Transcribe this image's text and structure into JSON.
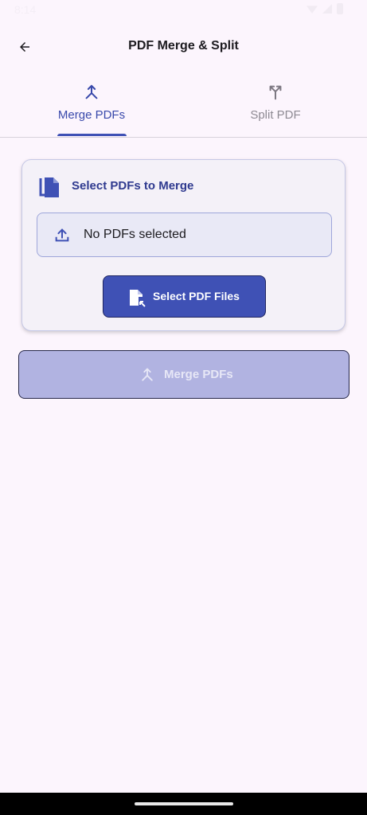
{
  "status_bar": {
    "time": "8:14"
  },
  "app_bar": {
    "title": "PDF Merge & Split"
  },
  "tabs": [
    {
      "label": "Merge PDFs",
      "icon": "merge-icon",
      "active": true
    },
    {
      "label": "Split PDF",
      "icon": "split-icon",
      "active": false
    }
  ],
  "merge_card": {
    "title": "Select PDFs to Merge",
    "header_icon": "file-copy-icon",
    "selection_text": "No PDFs selected",
    "selection_icon": "upload-icon",
    "select_button_label": "Select PDF Files",
    "select_button_icon": "file-open-icon"
  },
  "merge_button": {
    "label": "Merge PDFs",
    "icon": "merge-icon",
    "enabled": false
  },
  "colors": {
    "accent": "#3f51b5",
    "background": "#fcf5fd",
    "disabled_button": "#b1b3e1"
  }
}
